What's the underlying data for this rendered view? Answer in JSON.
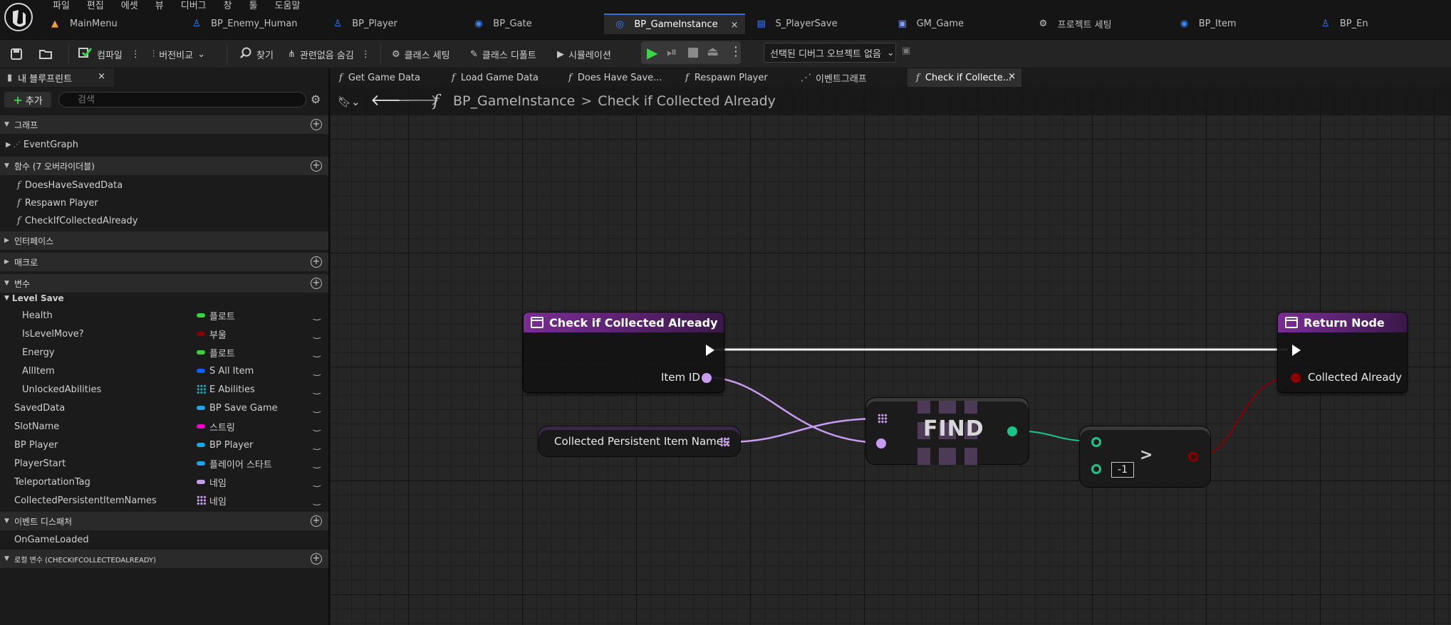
{
  "app": {
    "menu": [
      "파일",
      "편집",
      "에셋",
      "뷰",
      "디버그",
      "창",
      "툴",
      "도움말"
    ],
    "doc_tabs": [
      {
        "label": "MainMenu",
        "icon": "level-icon",
        "active": false
      },
      {
        "label": "BP_Enemy_Human",
        "icon": "pawn-icon",
        "active": false
      },
      {
        "label": "BP_Player",
        "icon": "pawn-icon",
        "active": false
      },
      {
        "label": "BP_Gate",
        "icon": "actor-icon",
        "active": false
      },
      {
        "label": "BP_GameInstance",
        "icon": "game-instance-icon",
        "active": true
      },
      {
        "label": "S_PlayerSave",
        "icon": "struct-icon",
        "active": false
      },
      {
        "label": "GM_Game",
        "icon": "game-mode-icon",
        "active": false
      },
      {
        "label": "프로젝트 세팅",
        "icon": "settings-icon",
        "active": false
      },
      {
        "label": "BP_Item",
        "icon": "actor-icon",
        "active": false
      },
      {
        "label": "BP_En",
        "icon": "pawn-icon",
        "active": false
      }
    ],
    "tab_close": "×"
  },
  "toolbar": {
    "compile": "컴파일",
    "diff": "버전비교",
    "find": "찾기",
    "hide_unrelated": "관련없음 숨김",
    "class_settings": "클래스 세팅",
    "class_defaults": "클래스 디폴트",
    "simulation": "시뮬레이션",
    "debug_object": "선택된 디버그 오브젝트 없음"
  },
  "left_panel": {
    "tab_label": "내 블루프린트",
    "add_label": "추가",
    "search_placeholder": "검색",
    "sections": {
      "graphs": "그래프",
      "functions": "함수 (7 오버라이더블)",
      "interfaces": "인터페이스",
      "macros": "매크로",
      "variables": "변수",
      "dispatchers": "이벤트 디스패처",
      "local_vars": "로컬 변수 (CHECKIFCOLLECTEDALREADY)"
    },
    "graph_items": [
      "EventGraph"
    ],
    "function_items": [
      "DoesHaveSavedData",
      "Respawn Player",
      "CheckIfCollectedAlready"
    ],
    "variable_category": "Level Save",
    "category_vars": [
      {
        "name": "Health",
        "type": "플로트",
        "color": "#3bd33b",
        "kind": "pill"
      },
      {
        "name": "IsLevelMove?",
        "type": "부울",
        "color": "#8a0000",
        "kind": "pill"
      },
      {
        "name": "Energy",
        "type": "플로트",
        "color": "#3bd33b",
        "kind": "pill"
      },
      {
        "name": "AllItem",
        "type": "S All Item",
        "color": "#1060ff",
        "kind": "pill"
      },
      {
        "name": "UnlockedAbilities",
        "type": "E Abilities",
        "color": "#1aa3b3",
        "kind": "grid"
      }
    ],
    "vars": [
      {
        "name": "SavedData",
        "type": "BP Save Game",
        "color": "#1aa6e8",
        "kind": "pill"
      },
      {
        "name": "SlotName",
        "type": "스트링",
        "color": "#ff00c8",
        "kind": "pill"
      },
      {
        "name": "BP Player",
        "type": "BP Player",
        "color": "#1aa6e8",
        "kind": "pill"
      },
      {
        "name": "PlayerStart",
        "type": "플레이어 스타트",
        "color": "#1aa6e8",
        "kind": "pill"
      },
      {
        "name": "TeleportationTag",
        "type": "네임",
        "color": "#c79cf0",
        "kind": "pill"
      },
      {
        "name": "CollectedPersistentItemNames",
        "type": "네임",
        "color": "#c79cf0",
        "kind": "grid-lav"
      }
    ],
    "dispatcher_items": [
      "OnGameLoaded"
    ]
  },
  "graph_tabs": [
    {
      "label": "Get Game Data",
      "active": false
    },
    {
      "label": "Load Game Data",
      "active": false
    },
    {
      "label": "Does Have Save...",
      "active": false
    },
    {
      "label": "Respawn Player",
      "active": false
    },
    {
      "label": "이벤트그래프",
      "active": false
    },
    {
      "label": "Check if Collecte...",
      "active": true
    }
  ],
  "breadcrumb": {
    "root": "BP_GameInstance",
    "sep": ">",
    "current": "Check if Collected Already"
  },
  "nodes": {
    "entry_title": "Check if Collected Already",
    "entry_pin": "Item ID",
    "return_title": "Return Node",
    "return_pin": "Collected Already",
    "var_get_label": "Collected Persistent Item Names",
    "find_label": "FIND",
    "compare_op": ">",
    "compare_const": "-1"
  },
  "colors": {
    "function_header": "#7a2c93",
    "name_pin": "#c79cf0",
    "int_pin": "#1dc48a",
    "bool_pin": "#8a0000",
    "active_tab_accent": "#3b6fd6"
  }
}
